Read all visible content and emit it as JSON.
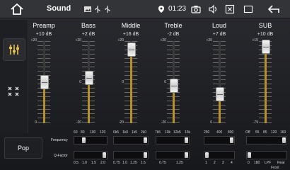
{
  "header": {
    "title": "Sound",
    "clock": "01:23",
    "status_icons": [
      "image-icon",
      "usb-icon",
      "usb-icon"
    ],
    "right_icons": [
      "camera-icon",
      "volume-icon",
      "close-box-icon",
      "back-icon"
    ]
  },
  "left_panel": {
    "items": [
      {
        "icon": "equalizer-sliders-icon",
        "active": true
      },
      {
        "icon": "balance-fader-icon",
        "active": false
      }
    ]
  },
  "bands": [
    {
      "name": "Preamp",
      "value": "+10 dB",
      "scale_top": "+20",
      "scale_mid": "",
      "scale_bot": "0",
      "level": 0.5
    },
    {
      "name": "Bass",
      "value": "+2 dB",
      "scale_top": "+20",
      "scale_mid": "0",
      "scale_bot": "-20",
      "level": 0.55
    },
    {
      "name": "Middle",
      "value": "+16 dB",
      "scale_top": "+20",
      "scale_mid": "0",
      "scale_bot": "-20",
      "level": 0.9
    },
    {
      "name": "Treble",
      "value": "-2 dB",
      "scale_top": "+20",
      "scale_mid": "0",
      "scale_bot": "-20",
      "level": 0.45
    },
    {
      "name": "Loud",
      "value": "+7 dB",
      "scale_top": "+20",
      "scale_mid": "",
      "scale_bot": "0",
      "level": 0.35
    },
    {
      "name": "SUB",
      "value": "+10 dB",
      "scale_top": "+15",
      "scale_mid": "",
      "scale_bot": "-79",
      "level": 0.95
    }
  ],
  "preset": {
    "label": "Pop"
  },
  "rows": {
    "frequency_label": "Frequency",
    "qfactor_label": "Q-Factor"
  },
  "freq_sliders": [
    {
      "ticks": [
        "60",
        "80",
        "100",
        "120"
      ],
      "selected": 1
    },
    {
      "ticks": [
        "0k5",
        "1k0",
        "1k5",
        "2k0"
      ],
      "selected": 3
    },
    {
      "ticks": [
        "7k5",
        "10k",
        "12k5",
        "15k"
      ],
      "selected": 3
    },
    {
      "ticks": [
        "250",
        "400",
        "800"
      ],
      "selected": 2
    },
    {
      "ticks": [
        "Off",
        "55",
        "85",
        "120",
        "160"
      ],
      "selected": 4
    }
  ],
  "q_sliders": [
    {
      "ticks": [
        "0.5",
        "1.0",
        "1.5",
        "2.0"
      ],
      "selected": 3
    },
    {
      "ticks": [
        "0.75",
        "1.0",
        "1.25",
        "1.5"
      ],
      "selected": 3
    },
    {
      "ticks": [
        "0.75",
        "1.25"
      ],
      "selected": 1
    },
    {
      "ticks": [
        "1",
        "2",
        "3",
        "4"
      ],
      "selected": 0
    },
    {
      "ticks": [
        "0",
        "180",
        "LPF",
        "Rear"
      ],
      "selected": 0,
      "extra": "Front"
    }
  ],
  "colors": {
    "accent": "#b89023",
    "background": "#1c1d20",
    "bar": "#333438"
  }
}
